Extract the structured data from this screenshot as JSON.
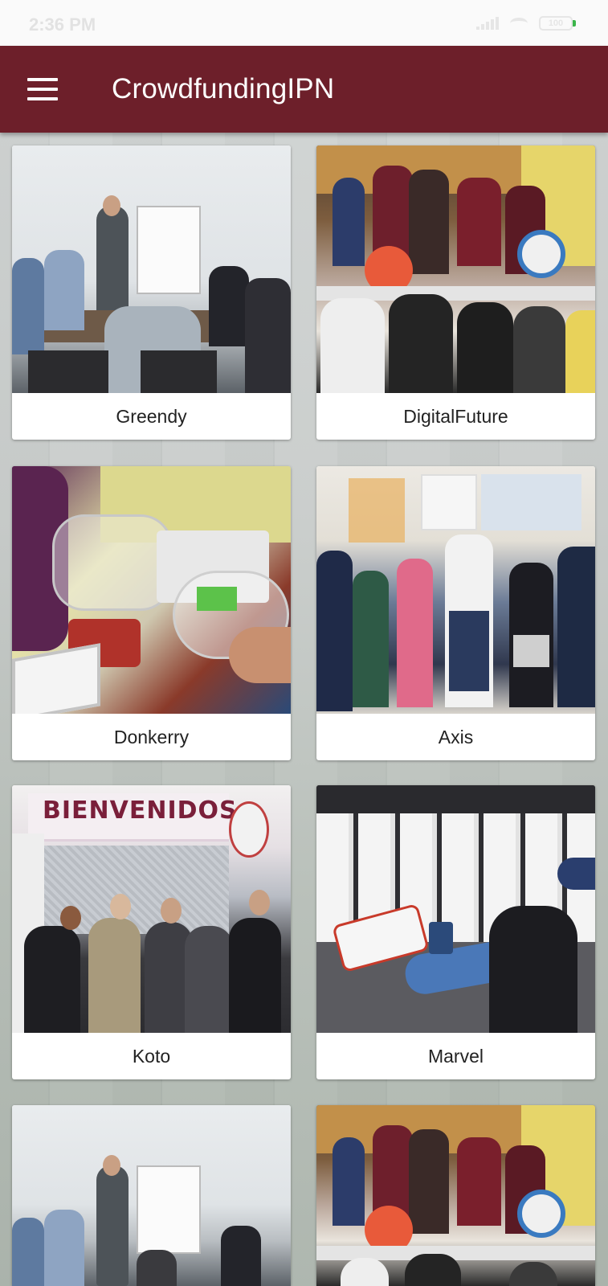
{
  "status_bar": {
    "time": "2:36 PM",
    "battery": "100"
  },
  "app_bar": {
    "title": "CrowdfundingIPN"
  },
  "cards": [
    {
      "label": "Greendy"
    },
    {
      "label": "DigitalFuture"
    },
    {
      "label": "Donkerry"
    },
    {
      "label": "Axis"
    },
    {
      "label": "Koto"
    },
    {
      "label": "Marvel"
    }
  ],
  "koto_sign": "BIENVENIDOS",
  "colors": {
    "app_bar": "#6d1f2a",
    "status_bar": "#fafafa",
    "card": "#ffffff"
  }
}
